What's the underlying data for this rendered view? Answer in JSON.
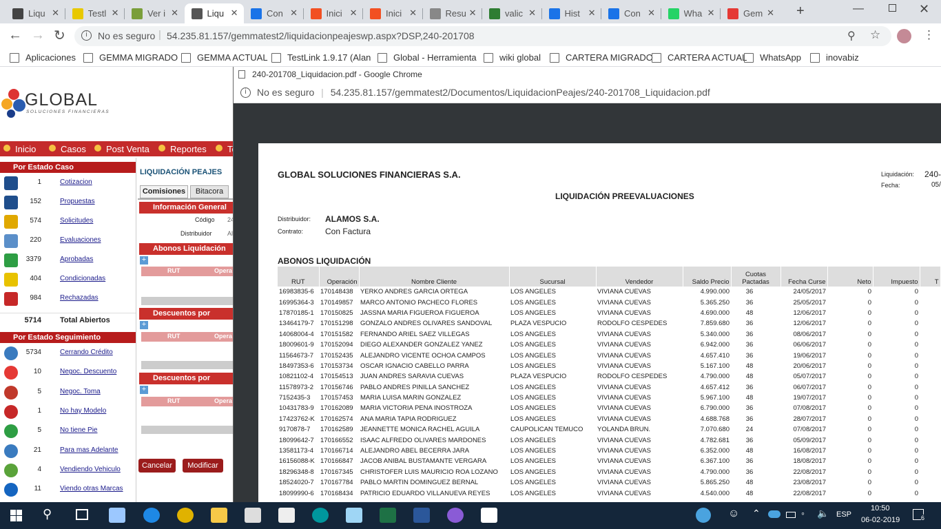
{
  "tabs": [
    {
      "title": "Liqu",
      "active": false
    },
    {
      "title": "Testl",
      "active": false
    },
    {
      "title": "Ver i",
      "active": false
    },
    {
      "title": "Liqu",
      "active": true
    },
    {
      "title": "Con",
      "active": false
    },
    {
      "title": "Inici",
      "active": false
    },
    {
      "title": "Inici",
      "active": false
    },
    {
      "title": "Resu",
      "active": false
    },
    {
      "title": "valic",
      "active": false
    },
    {
      "title": "Hist",
      "active": false
    },
    {
      "title": "Con",
      "active": false
    },
    {
      "title": "Wha",
      "active": false
    },
    {
      "title": "Gem",
      "active": false
    }
  ],
  "address": {
    "security": "No es seguro",
    "url": "54.235.81.157/gemmatest2/liquidacionpeajeswp.aspx?DSP,240-201708"
  },
  "bookmarks": [
    "Aplicaciones",
    "GEMMA MIGRADO",
    "GEMMA ACTUAL",
    "TestLink 1.9.17 (Alan",
    "Global - Herramienta",
    "wiki global",
    "CARTERA MIGRADO",
    "CARTERA ACTUAL",
    "WhatsApp",
    "inovabiz"
  ],
  "app": {
    "logo_main": "GLOBAL",
    "logo_sub": "SOLUCIONES FINANCIERAS",
    "menu": [
      "Inicio",
      "Casos",
      "Post Venta",
      "Reportes",
      "To"
    ],
    "estado_caso": {
      "title": "Por Estado Caso",
      "items": [
        {
          "count": "1",
          "label": "Cotizacion"
        },
        {
          "count": "152",
          "label": "Propuestas"
        },
        {
          "count": "574",
          "label": "Solicitudes"
        },
        {
          "count": "220",
          "label": "Evaluaciones"
        },
        {
          "count": "3379",
          "label": "Aprobadas"
        },
        {
          "count": "404",
          "label": "Condicionadas"
        },
        {
          "count": "984",
          "label": "Rechazadas"
        }
      ],
      "total_count": "5714",
      "total_label": "Total Abiertos"
    },
    "estado_seguimiento": {
      "title": "Por Estado Seguimiento",
      "items": [
        {
          "count": "5734",
          "label": "Cerrando Crédito"
        },
        {
          "count": "10",
          "label": "Negoc. Descuento"
        },
        {
          "count": "5",
          "label": "Negoc. Toma"
        },
        {
          "count": "1",
          "label": "No hay Modelo"
        },
        {
          "count": "5",
          "label": "No tiene Pie"
        },
        {
          "count": "21",
          "label": "Para mas Adelante"
        },
        {
          "count": "4",
          "label": "Vendiendo Vehiculo"
        },
        {
          "count": "11",
          "label": "Viendo otras Marcas"
        }
      ]
    },
    "page_title": "LIQUIDACIÓN PEAJES",
    "tabs": [
      "Comisiones",
      "Bitacora"
    ],
    "info_general": "Información General",
    "codigo_label": "Código",
    "codigo_value": "24",
    "distribuidor_label": "Distribuidor",
    "distribuidor_value": "Al",
    "abonos": "Abonos Liquidación",
    "desc_prepago": "Descuentos por Prepag",
    "desc_anulacion": "Descuentos por Anulaci",
    "col_rut": "RUT",
    "col_oper": "Opera",
    "buttons": [
      "Cancelar",
      "Modificar"
    ]
  },
  "popup": {
    "window_title": "240-201708_Liquidacion.pdf - Google Chrome",
    "security": "No es seguro",
    "url": "54.235.81.157/gemmatest2/Documentos/LiquidacionPeajes/240-201708_Liquidacion.pdf"
  },
  "pdf": {
    "company": "GLOBAL SOLUCIONES FINANCIERAS S.A.",
    "liquidacion_label": "Liquidación:",
    "liquidacion_value": "240-",
    "fecha_label": "Fecha:",
    "fecha_value": "05/",
    "doc_title": "LIQUIDACIÓN PREEVALUACIONES",
    "distribuidor_label": "Distribuidor:",
    "distribuidor_value": "ALAMOS S.A.",
    "contrato_label": "Contrato:",
    "contrato_value": "Con Factura",
    "section_title": "ABONOS LIQUIDACIÓN",
    "columns": [
      "RUT",
      "Operación",
      "Nombre Cliente",
      "Sucursal",
      "Vendedor",
      "Saldo Precio",
      "Cuotas Pactadas",
      "Fecha Curse",
      "Neto",
      "Impuesto",
      "T"
    ],
    "rows": [
      [
        "16983835-6",
        "170148438",
        "YERKO ANDRES GARCIA ORTEGA",
        "LOS ANGELES",
        "VIVIANA CUEVAS",
        "4.990.000",
        "36",
        "24/05/2017",
        "0",
        "0"
      ],
      [
        "16995364-3",
        "170149857",
        "MARCO ANTONIO PACHECO FLORES",
        "LOS ANGELES",
        "VIVIANA CUEVAS",
        "5.365.250",
        "36",
        "25/05/2017",
        "0",
        "0"
      ],
      [
        "17870185-1",
        "170150825",
        "JASSNA MARIA FIGUEROA FIGUEROA",
        "LOS ANGELES",
        "VIVIANA CUEVAS",
        "4.690.000",
        "48",
        "12/06/2017",
        "0",
        "0"
      ],
      [
        "13464179-7",
        "170151298",
        "GONZALO ANDRES OLIVARES SANDOVAL",
        "PLAZA VESPUCIO",
        "RODOLFO CESPEDES",
        "7.859.680",
        "36",
        "12/06/2017",
        "0",
        "0"
      ],
      [
        "14068004-4",
        "170151582",
        "FERNANDO ARIEL SAEZ VILLEGAS",
        "LOS ANGELES",
        "VIVIANA CUEVAS",
        "5.340.000",
        "36",
        "08/06/2017",
        "0",
        "0"
      ],
      [
        "18009601-9",
        "170152094",
        "DIEGO ALEXANDER GONZALEZ YANEZ",
        "LOS ANGELES",
        "VIVIANA CUEVAS",
        "6.942.000",
        "36",
        "06/06/2017",
        "0",
        "0"
      ],
      [
        "11564673-7",
        "170152435",
        "ALEJANDRO VICENTE OCHOA CAMPOS",
        "LOS ANGELES",
        "VIVIANA CUEVAS",
        "4.657.410",
        "36",
        "19/06/2017",
        "0",
        "0"
      ],
      [
        "18497353-6",
        "170153734",
        "OSCAR IGNACIO CABELLO PARRA",
        "LOS ANGELES",
        "VIVIANA CUEVAS",
        "5.167.100",
        "48",
        "20/06/2017",
        "0",
        "0"
      ],
      [
        "10821102-4",
        "170154513",
        "JUAN ANDRES SARAVIA CUEVAS",
        "PLAZA VESPUCIO",
        "RODOLFO CESPEDES",
        "4.790.000",
        "48",
        "05/07/2017",
        "0",
        "0"
      ],
      [
        "11578973-2",
        "170156746",
        "PABLO ANDRES PINILLA SANCHEZ",
        "LOS ANGELES",
        "VIVIANA CUEVAS",
        "4.657.412",
        "36",
        "06/07/2017",
        "0",
        "0"
      ],
      [
        "7152435-3",
        "170157453",
        "MARIA LUISA MARIN GONZALEZ",
        "LOS ANGELES",
        "VIVIANA CUEVAS",
        "5.967.100",
        "48",
        "19/07/2017",
        "0",
        "0"
      ],
      [
        "10431783-9",
        "170162089",
        "MARIA VICTORIA PENA INOSTROZA",
        "LOS ANGELES",
        "VIVIANA CUEVAS",
        "6.790.000",
        "36",
        "07/08/2017",
        "0",
        "0"
      ],
      [
        "17423762-K",
        "170162574",
        "ANA MARIA TAPIA RODRIGUEZ",
        "LOS ANGELES",
        "VIVIANA CUEVAS",
        "4.688.768",
        "36",
        "28/07/2017",
        "0",
        "0"
      ],
      [
        "9170878-7",
        "170162589",
        "JEANNETTE MONICA RACHEL AGUILA",
        "CAUPOLICAN TEMUCO",
        "YOLANDA BRUN.",
        "7.070.680",
        "24",
        "07/08/2017",
        "0",
        "0"
      ],
      [
        "18099642-7",
        "170166552",
        "ISAAC ALFREDO OLIVARES MARDONES",
        "LOS ANGELES",
        "VIVIANA CUEVAS",
        "4.782.681",
        "36",
        "05/09/2017",
        "0",
        "0"
      ],
      [
        "13581173-4",
        "170166714",
        "ALEJANDRO ABEL BECERRA JARA",
        "LOS ANGELES",
        "VIVIANA CUEVAS",
        "6.352.000",
        "48",
        "16/08/2017",
        "0",
        "0"
      ],
      [
        "16156088-K",
        "170166847",
        "JACOB ANIBAL BUSTAMANTE VERGARA",
        "LOS ANGELES",
        "VIVIANA CUEVAS",
        "6.367.100",
        "36",
        "18/08/2017",
        "0",
        "0"
      ],
      [
        "18296348-8",
        "170167345",
        "CHRISTOFER LUIS MAURICIO ROA LOZANO",
        "LOS ANGELES",
        "VIVIANA CUEVAS",
        "4.790.000",
        "36",
        "22/08/2017",
        "0",
        "0"
      ],
      [
        "18524020-7",
        "170167784",
        "PABLO MARTIN DOMINGUEZ BERNAL",
        "LOS ANGELES",
        "VIVIANA CUEVAS",
        "5.865.250",
        "48",
        "23/08/2017",
        "0",
        "0"
      ],
      [
        "18099990-6",
        "170168434",
        "PATRICIO EDUARDO VILLANUEVA REYES",
        "LOS ANGELES",
        "VIVIANA CUEVAS",
        "4.540.000",
        "48",
        "22/08/2017",
        "0",
        "0"
      ]
    ]
  },
  "taskbar": {
    "lang": "ESP",
    "time": "10:50",
    "date": "06-02-2019",
    "notifications": "6"
  }
}
